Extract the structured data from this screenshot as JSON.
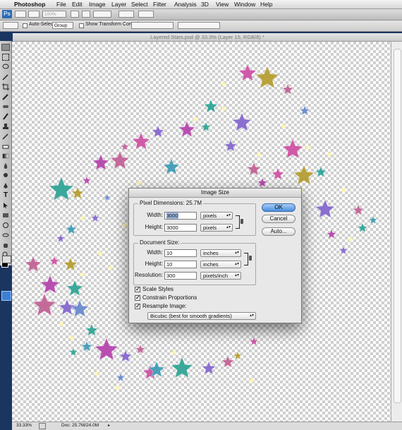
{
  "menubar": {
    "app_name": "Photoshop",
    "items": [
      "File",
      "Edit",
      "Image",
      "Layer",
      "Select",
      "Filter",
      "Analysis",
      "3D",
      "View",
      "Window",
      "Help"
    ]
  },
  "appbar": {
    "logo": "Ps",
    "zoom": "100%"
  },
  "options": {
    "auto_select_label": "Auto-Select:",
    "auto_select_value": "Group",
    "transform_label": "Show Transform Controls"
  },
  "document": {
    "title": "Layered Stars.psd @ 33.3% (Layer 15, RGB/8) *"
  },
  "status": {
    "zoom": "33.33%",
    "doc_size": "Doc: 25.7M/24.0M"
  },
  "dialog": {
    "title": "Image Size",
    "pixel_dimensions_label": "Pixel Dimensions: 25.7M",
    "width_label": "Width:",
    "height_label": "Height:",
    "pixel_width": "3000",
    "pixel_height": "3000",
    "pixel_unit": "pixels",
    "document_size_label": "Document Size:",
    "doc_width": "10",
    "doc_height": "10",
    "doc_unit": "inches",
    "resolution_label": "Resolution:",
    "resolution": "300",
    "resolution_unit": "pixels/inch",
    "ok": "OK",
    "cancel": "Cancel",
    "auto": "Auto...",
    "scale_styles": "Scale Styles",
    "constrain": "Constrain Proportions",
    "resample": "Resample Image:",
    "resample_method": "Bicubic (best for smooth gradients)"
  },
  "colors": {
    "accent": "#4a8fe0",
    "desktop": "#1a3560"
  }
}
